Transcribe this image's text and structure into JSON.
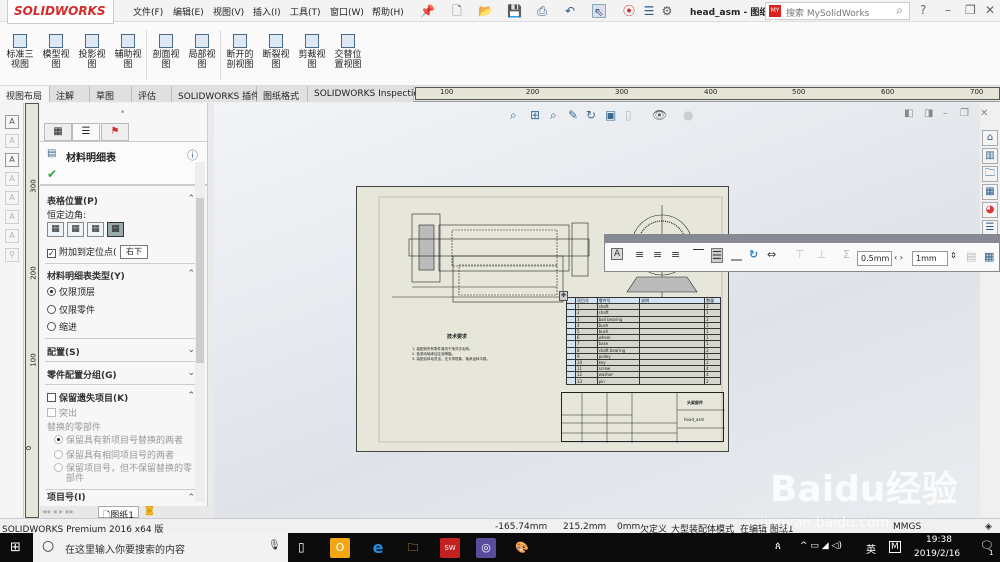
{
  "app": {
    "logo": "SOLIDWORKS",
    "title": "head_asm - 图纸...",
    "search_placeholder": "搜索 MySolidWorks",
    "search_logo": "MY SW"
  },
  "menu": [
    "文件(F)",
    "编辑(E)",
    "视图(V)",
    "插入(I)",
    "工具(T)",
    "窗口(W)",
    "帮助(H)"
  ],
  "ribbon": [
    [
      "标准三",
      "视图"
    ],
    [
      "模型视",
      "图"
    ],
    [
      "投影视",
      "图"
    ],
    [
      "辅助视",
      "图"
    ],
    [
      "剖面视",
      "图"
    ],
    [
      "局部视",
      "图"
    ],
    [
      "断开的",
      "剖视图"
    ],
    [
      "断裂视",
      "图"
    ],
    [
      "剪裁视",
      "图"
    ],
    [
      "交替位",
      "置视图"
    ]
  ],
  "tabs": [
    "视图布局",
    "注解",
    "草图",
    "评估",
    "SOLIDWORKS 插件",
    "图纸格式",
    "SOLIDWORKS Inspection"
  ],
  "hruler": [
    "100",
    "200",
    "300",
    "400",
    "500",
    "600",
    "700"
  ],
  "vruler": [
    "300",
    "200",
    "100",
    "0"
  ],
  "panel": {
    "title": "材料明细表",
    "table_position": {
      "header": "表格位置(P)",
      "anchor_label": "恒定边角:",
      "attach_label": "附加到定位点(",
      "tooltip": "右下"
    },
    "bom_type": {
      "header": "材料明细表类型(Y)",
      "options": [
        "仅限顶层",
        "仅限零件",
        "缩进"
      ],
      "selected": 0
    },
    "config": {
      "header": "配置(S)"
    },
    "part_config_group": {
      "header": "零件配置分组(G)"
    },
    "keep_missing": {
      "header": "保留遗失项目(K)",
      "strike": "突出",
      "replaced_label": "替换的零部件",
      "options": [
        "保留具有新项目号替换的两者",
        "保留具有相同项目号的两者",
        "保留项目号，但不保留替换的零部件"
      ]
    },
    "item_no": {
      "header": "项目号(I)"
    }
  },
  "sheet_tab": "图纸1",
  "drawing": {
    "tech_title": "技术要求",
    "tech_notes": [
      "1. 装配前所有零件清洗干净并去毛刺。",
      "2. 各滚动轴承加注润滑脂。",
      "3. 装配后转动灵活，无卡滞现象，轴承运转平稳。"
    ],
    "title_block": {
      "name": "头架部件",
      "drawing_no": "head_asm"
    },
    "bom": {
      "headers": [
        "项目号",
        "零件号",
        "说明",
        "数量"
      ],
      "rows": [
        [
          "1",
          "shaft",
          "",
          "1"
        ],
        [
          "2",
          "shaft",
          "",
          "1"
        ],
        [
          "3",
          "ball bearing",
          "",
          "2"
        ],
        [
          "4",
          "bush",
          "",
          "1"
        ],
        [
          "5",
          "bush",
          "",
          "1"
        ],
        [
          "6",
          "wheel",
          "",
          "1"
        ],
        [
          "7",
          "base",
          "",
          "1"
        ],
        [
          "8",
          "shaft bearing",
          "",
          "2"
        ],
        [
          "9",
          "pulley",
          "",
          "1"
        ],
        [
          "10",
          "key",
          "",
          "2"
        ],
        [
          "11",
          "screw",
          "",
          "4"
        ],
        [
          "12",
          "washer",
          "",
          "4"
        ],
        [
          "13",
          "pin",
          "",
          "2"
        ]
      ]
    }
  },
  "table_toolbar": {
    "border_width": "0.5mm",
    "cell_padding": "1mm"
  },
  "status": {
    "product": "SOLIDWORKS Premium 2016 x64 版",
    "x": "-165.74mm",
    "y": "215.2mm",
    "z": "0mm",
    "state": "欠定义",
    "mode": "大型装配体模式",
    "editing": "在编辑 图纸1",
    "units": "MMGS"
  },
  "taskbar": {
    "search": "在这里输入你要搜索的内容",
    "ime": "英",
    "time": "19:38",
    "date": "2019/2/16",
    "notif": "1"
  },
  "watermark": {
    "text": "Baidu经验",
    "url": "jingyan.baidu.com"
  }
}
